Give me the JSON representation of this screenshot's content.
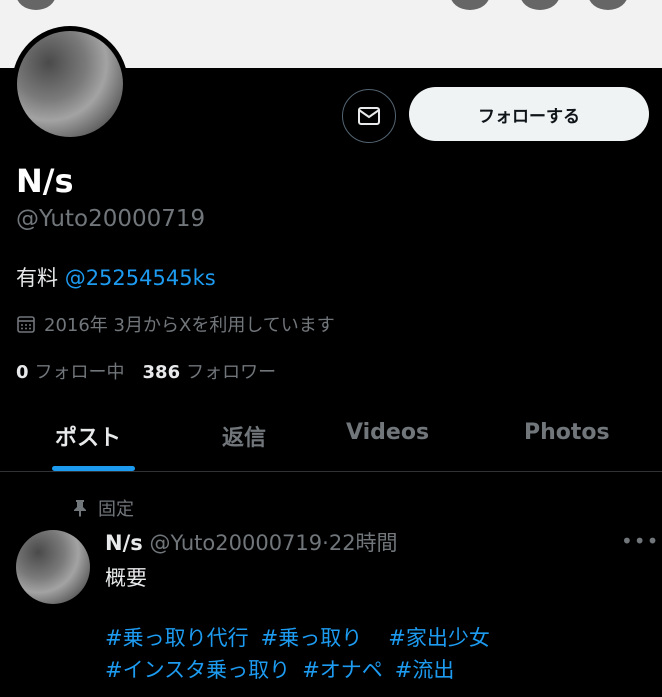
{
  "profile": {
    "name": "N/s",
    "handle": "@Yuto20000719",
    "bio_text": "有料",
    "bio_link": "@25254545ks",
    "joined": "2016年 3月からXを利用しています",
    "following_count": "0",
    "following_label": "フォロー中",
    "followers_count": "386",
    "followers_label": "フォロワー"
  },
  "actions": {
    "follow_label": "フォローする",
    "message_icon": "mail-icon"
  },
  "tabs": [
    {
      "label": "ポスト"
    },
    {
      "label": "返信"
    },
    {
      "label": "Videos"
    },
    {
      "label": "Photos"
    }
  ],
  "post": {
    "pinned_label": "固定",
    "author_name": "N/s",
    "author_handle": "@Yuto20000719",
    "separator": "·",
    "time": "22時間",
    "more": "•••",
    "text": "概要",
    "hashtags_line1": [
      "#乗っ取り代行",
      "#乗っ取り",
      "#家出少女"
    ],
    "hashtags_line2": [
      "#インスタ乗っ取り",
      "#オナペ",
      "#流出"
    ]
  },
  "colors": {
    "accent": "#1d9bf0",
    "background": "#000000",
    "muted": "#71767b"
  }
}
